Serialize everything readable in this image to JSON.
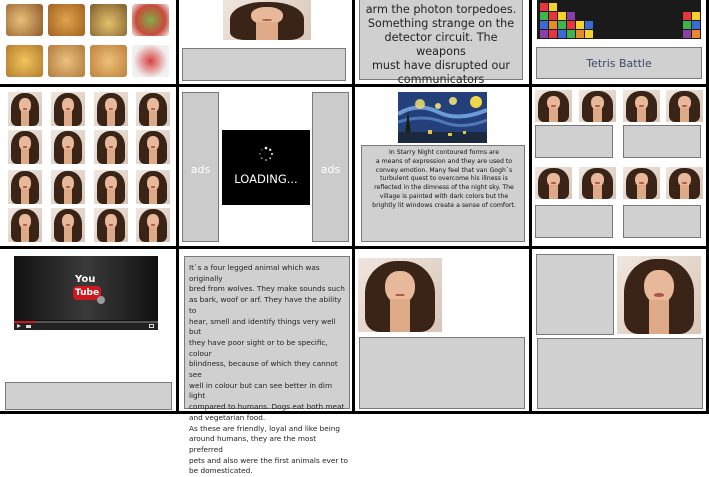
{
  "top_middle_text": {
    "lines": [
      "arm the photon torpedoes.",
      "Something strange on the",
      "detector circuit. The weapons",
      "must have disrupted our",
      "communicators"
    ]
  },
  "tetris": {
    "label": "Tetris Battle"
  },
  "ads": {
    "left_label": "ads",
    "right_label": "ads"
  },
  "loading": {
    "label": "LOADING..."
  },
  "starry": {
    "lines": [
      "In Starry Night contoured forms are",
      "a means of expression and they are used to",
      "convey emotion. Many feel that van Gogh`s",
      "turbulent quest to overcome his illness is",
      "reflected in the dimness of the night sky. The",
      "village is painted with dark colors but the",
      "brightly lit windows create a sense of comfort."
    ]
  },
  "youtube": {
    "logo_top": "You",
    "logo_bottom": "Tube"
  },
  "dog_text": {
    "lines": [
      "It`s a four legged animal which was originally",
      "bred from wolves. They make sounds such",
      "as bark, woof or arf. They have the ability to",
      "hear, smell and identify things very well but",
      "they have poor sight or to be specific, colour",
      "blindness, because of which they cannot see",
      "well in colour but can see better in dim light",
      "compared to humans. Dogs eat both meat",
      "and vegetarian food.",
      "As these are friendly, loyal and like being",
      "around humans, they are the most preferred",
      "pets and also were the first animals ever to",
      "be domesticated."
    ]
  },
  "colors": {
    "panel_gray": "#d0d0d0",
    "loading_bg": "#000000",
    "youtube_red": "#cc181e"
  },
  "icons": [
    "loading-spinner-icon",
    "youtube-logo-icon",
    "play-icon"
  ]
}
